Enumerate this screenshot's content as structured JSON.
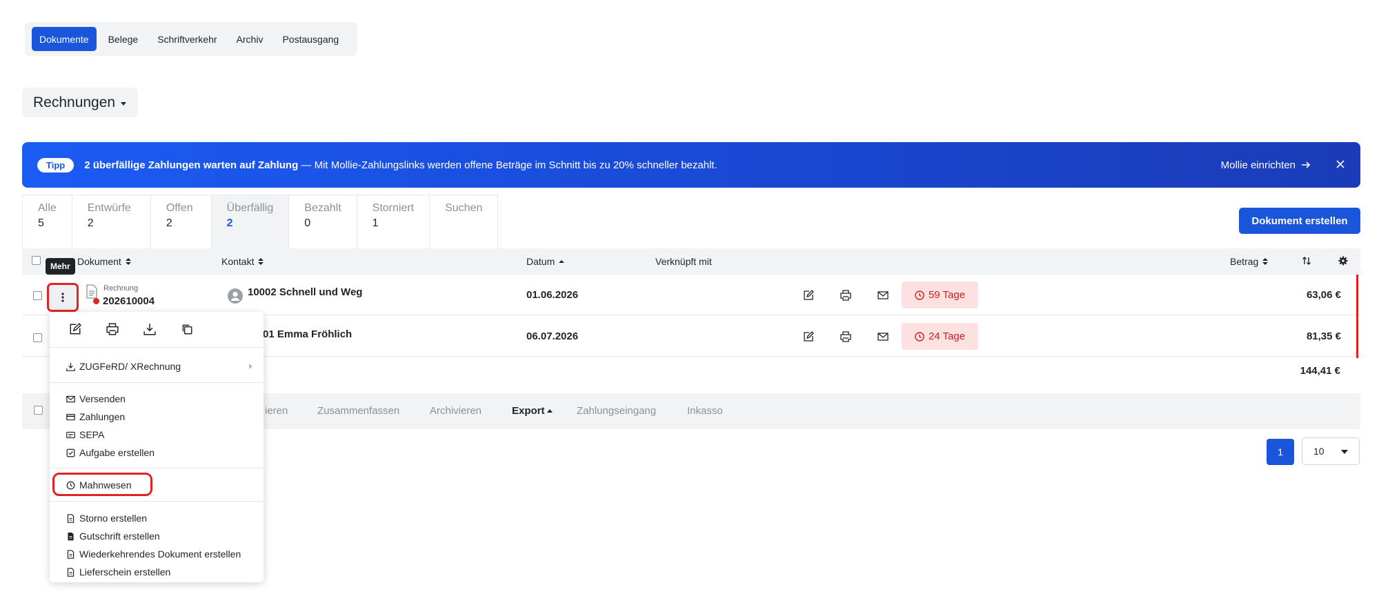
{
  "top_tabs": [
    "Dokumente",
    "Belege",
    "Schriftverkehr",
    "Archiv",
    "Postausgang"
  ],
  "doc_type": "Rechnungen",
  "banner": {
    "badge": "Tipp",
    "bold_text": "2 überfällige Zahlungen warten auf Zahlung",
    "text": " — Mit Mollie-Zahlungslinks werden offene Beträge im Schnitt bis zu 20% schneller bezahlt.",
    "link": "Mollie einrichten"
  },
  "status_tabs": [
    {
      "label": "Alle",
      "count": "5"
    },
    {
      "label": "Entwürfe",
      "count": "2"
    },
    {
      "label": "Offen",
      "count": "2"
    },
    {
      "label": "Überfällig",
      "count": "2"
    },
    {
      "label": "Bezahlt",
      "count": "0"
    },
    {
      "label": "Storniert",
      "count": "1"
    },
    {
      "label": "Suchen",
      "count": ""
    }
  ],
  "create_button": "Dokument erstellen",
  "columns": {
    "dokument": "Dokument",
    "kontakt": "Kontakt",
    "datum": "Datum",
    "verknuepft": "Verknüpft mit",
    "betrag": "Betrag"
  },
  "rows": [
    {
      "doc_type": "Rechnung",
      "doc_number": "202610004",
      "contact": "10002 Schnell und Weg",
      "date": "01.06.2026",
      "deadline": "59 Tage",
      "amount": "63,06 €"
    },
    {
      "contact": "01 Emma Fröhlich",
      "date": "06.07.2026",
      "deadline": "24 Tage",
      "amount": "81,35 €"
    }
  ],
  "total": "144,41 €",
  "bulk_actions": {
    "partial": "ieren",
    "zusammenfassen": "Zusammenfassen",
    "archivieren": "Archivieren",
    "export": "Export",
    "zahlungseingang": "Zahlungseingang",
    "inkasso": "Inkasso"
  },
  "pagination": {
    "page": "1",
    "per_page": "10"
  },
  "tooltip": "Mehr",
  "menu": {
    "zugferd": "ZUGFeRD/ XRechnung",
    "versenden": "Versenden",
    "zahlungen": "Zahlungen",
    "sepa": "SEPA",
    "aufgabe": "Aufgabe erstellen",
    "mahnwesen": "Mahnwesen",
    "storno": "Storno erstellen",
    "gutschrift": "Gutschrift erstellen",
    "wiederkehrend": "Wiederkehrendes Dokument erstellen",
    "lieferschein": "Lieferschein erstellen"
  },
  "colors": {
    "accent": "#1a56db",
    "danger": "#e02424",
    "deadline_bg": "#fde1e1"
  }
}
